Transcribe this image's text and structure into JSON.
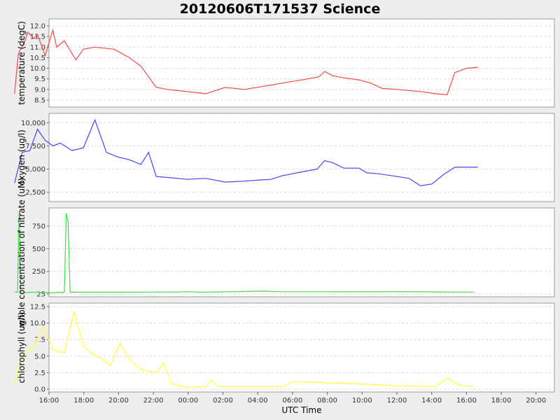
{
  "chart_data": {
    "type": "line",
    "title": "20120606T171537 Science",
    "xlabel": "UTC Time",
    "x_tick_labels": [
      "16:00",
      "18:00",
      "20:00",
      "22:00",
      "00:00",
      "02:00",
      "04:00",
      "06:00",
      "08:00",
      "10:00",
      "12:00",
      "14:00",
      "16:00",
      "18:00",
      "20:00"
    ],
    "xlim_hours": [
      15.9,
      29.1
    ],
    "grid": true,
    "colors": {
      "background": "#eeeeee",
      "plot_bg": "#ffffff",
      "grid": "#d8d8d8"
    },
    "panels": [
      {
        "ylabel": "temperature (degC)",
        "color": "#ff4444",
        "ylim": [
          8.3,
          12.2
        ],
        "yticks": [
          8.5,
          9.0,
          9.5,
          10.0,
          10.5,
          11.0,
          11.5,
          12.0
        ],
        "ytick_labels": [
          "8.5",
          "9.0",
          "9.5",
          "10.0",
          "10.5",
          "11.0",
          "11.5",
          "12.0"
        ],
        "series": [
          {
            "points": [
              [
                15.0,
                8.8
              ],
              [
                15.1,
                10.7
              ],
              [
                15.25,
                11.2
              ],
              [
                15.35,
                11.7
              ],
              [
                15.5,
                11.4
              ],
              [
                15.6,
                11.6
              ],
              [
                15.8,
                10.6
              ],
              [
                16.0,
                11.8
              ],
              [
                16.1,
                11.0
              ],
              [
                16.3,
                11.3
              ],
              [
                16.6,
                10.4
              ],
              [
                16.8,
                10.9
              ],
              [
                17.1,
                11.0
              ],
              [
                17.6,
                10.9
              ],
              [
                18.0,
                10.5
              ],
              [
                18.3,
                10.1
              ],
              [
                18.7,
                9.1
              ],
              [
                19.0,
                9.0
              ],
              [
                19.5,
                8.9
              ],
              [
                20.0,
                8.8
              ],
              [
                20.5,
                9.1
              ],
              [
                21.0,
                9.0
              ],
              [
                21.5,
                9.15
              ],
              [
                22.0,
                9.3
              ],
              [
                22.5,
                9.45
              ],
              [
                22.95,
                9.6
              ],
              [
                23.1,
                9.85
              ],
              [
                23.3,
                9.65
              ],
              [
                23.6,
                9.55
              ],
              [
                24.0,
                9.45
              ],
              [
                24.3,
                9.3
              ],
              [
                24.6,
                9.05
              ],
              [
                25.0,
                9.0
              ],
              [
                25.3,
                8.95
              ],
              [
                25.6,
                8.9
              ],
              [
                26.0,
                8.8
              ],
              [
                26.3,
                8.75
              ],
              [
                26.5,
                9.8
              ],
              [
                26.8,
                10.0
              ],
              [
                27.1,
                10.05
              ]
            ]
          }
        ]
      },
      {
        "ylabel": "oxygen (ug/l)",
        "color": "#4444ff",
        "ylim": [
          1800,
          10700
        ],
        "yticks": [
          2500,
          5000,
          7500,
          10000
        ],
        "ytick_labels": [
          "2,500",
          "5,000",
          "7,500",
          "10,000"
        ],
        "series": [
          {
            "points": [
              [
                15.0,
                3500
              ],
              [
                15.2,
                6800
              ],
              [
                15.4,
                7000
              ],
              [
                15.6,
                9300
              ],
              [
                15.8,
                8100
              ],
              [
                16.0,
                7500
              ],
              [
                16.2,
                7800
              ],
              [
                16.5,
                7000
              ],
              [
                16.8,
                7300
              ],
              [
                17.1,
                10300
              ],
              [
                17.4,
                6800
              ],
              [
                17.7,
                6300
              ],
              [
                18.0,
                6000
              ],
              [
                18.3,
                5500
              ],
              [
                18.5,
                6800
              ],
              [
                18.7,
                4200
              ],
              [
                19.0,
                4100
              ],
              [
                19.5,
                3900
              ],
              [
                20.0,
                4000
              ],
              [
                20.5,
                3600
              ],
              [
                21.0,
                3700
              ],
              [
                21.3,
                3800
              ],
              [
                21.7,
                3900
              ],
              [
                22.0,
                4300
              ],
              [
                22.5,
                4700
              ],
              [
                22.9,
                5000
              ],
              [
                23.1,
                5900
              ],
              [
                23.3,
                5700
              ],
              [
                23.6,
                5100
              ],
              [
                24.0,
                5100
              ],
              [
                24.2,
                4600
              ],
              [
                24.5,
                4500
              ],
              [
                25.0,
                4200
              ],
              [
                25.3,
                4000
              ],
              [
                25.6,
                3200
              ],
              [
                25.9,
                3400
              ],
              [
                26.2,
                4400
              ],
              [
                26.5,
                5200
              ],
              [
                26.8,
                5200
              ],
              [
                27.1,
                5200
              ]
            ]
          }
        ]
      },
      {
        "ylabel": "whole concentration of nitrate (uM)",
        "color": "#44dd44",
        "ylim": [
          0,
          920
        ],
        "yticks": [
          0,
          250,
          500,
          750
        ],
        "ytick_labels": [
          "25",
          "250",
          "500",
          "750"
        ],
        "series": [
          {
            "points": [
              [
                15.0,
                20
              ],
              [
                15.08,
                20
              ],
              [
                15.12,
                910
              ],
              [
                15.16,
                15
              ],
              [
                15.5,
                20
              ],
              [
                16.0,
                15
              ],
              [
                16.3,
                20
              ],
              [
                16.35,
                890
              ],
              [
                16.4,
                800
              ],
              [
                16.45,
                20
              ],
              [
                17.0,
                20
              ],
              [
                18.0,
                20
              ],
              [
                19.0,
                22
              ],
              [
                19.5,
                25
              ],
              [
                20.0,
                20
              ],
              [
                21.0,
                28
              ],
              [
                21.5,
                32
              ],
              [
                22.0,
                25
              ],
              [
                24.0,
                24
              ],
              [
                25.0,
                26
              ],
              [
                25.5,
                24
              ],
              [
                26.0,
                23
              ],
              [
                26.5,
                22
              ],
              [
                27.0,
                21
              ]
            ]
          }
        ]
      },
      {
        "ylabel": "chlorophyll (ug/l)",
        "color": "#ffff33",
        "ylim": [
          0,
          12.6
        ],
        "yticks": [
          0.0,
          2.5,
          5.0,
          7.5,
          10.0,
          12.5
        ],
        "ytick_labels": [
          "0.0",
          "2.5",
          "5.0",
          "7.5",
          "10.0",
          "12.5"
        ],
        "series": [
          {
            "points": [
              [
                15.0,
                0.5
              ],
              [
                15.2,
                5.0
              ],
              [
                15.5,
                6.5
              ],
              [
                15.75,
                9.5
              ],
              [
                16.0,
                6.0
              ],
              [
                16.3,
                5.5
              ],
              [
                16.55,
                11.8
              ],
              [
                16.8,
                6.5
              ],
              [
                17.0,
                5.5
              ],
              [
                17.3,
                4.5
              ],
              [
                17.5,
                3.5
              ],
              [
                17.75,
                7.0
              ],
              [
                18.0,
                4.5
              ],
              [
                18.3,
                3.0
              ],
              [
                18.7,
                2.5
              ],
              [
                18.9,
                4.0
              ],
              [
                19.1,
                0.8
              ],
              [
                19.5,
                0.3
              ],
              [
                20.0,
                0.4
              ],
              [
                20.15,
                1.4
              ],
              [
                20.3,
                0.4
              ],
              [
                21.0,
                0.4
              ],
              [
                22.0,
                0.4
              ],
              [
                22.3,
                1.2
              ],
              [
                23.0,
                1.0
              ],
              [
                24.0,
                0.8
              ],
              [
                25.0,
                0.5
              ],
              [
                26.0,
                0.4
              ],
              [
                26.3,
                1.7
              ],
              [
                26.6,
                0.6
              ],
              [
                27.0,
                0.4
              ]
            ]
          }
        ]
      }
    ]
  }
}
